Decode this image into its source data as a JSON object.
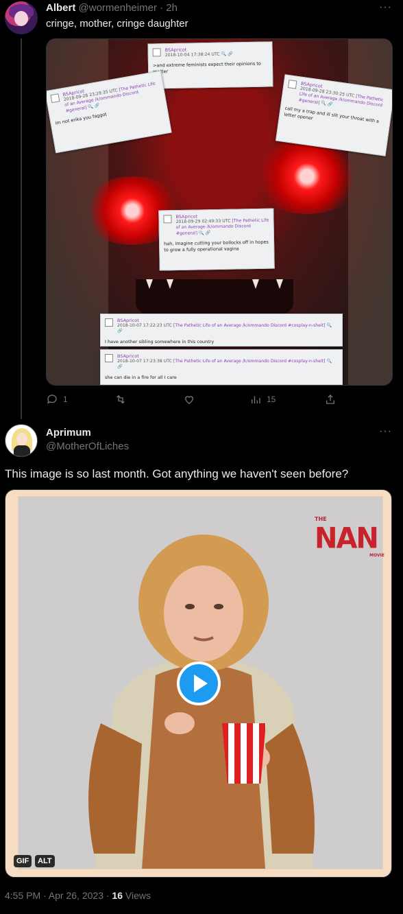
{
  "tweet1": {
    "name": "Albert",
    "handle": "@wormenheimer",
    "separator": "·",
    "time": "2h",
    "more": "···",
    "text": "cringe, mother, cringe daughter",
    "image_cards": [
      {
        "user": "BSApricot",
        "meta": "2018-10-04 17:38:24 UTC",
        "links": "🔍 🔗",
        "body": ">and extreme feminists expect their opinions to matter"
      },
      {
        "user": "BSApricot",
        "meta": "2018-09-28 23:29:35 UTC",
        "links": "[The Pathetic Life of an Average /k/ommando Discord #general] 🔍 🔗",
        "body": "im not erika you faggot"
      },
      {
        "user": "BSApricot",
        "meta": "2018-09-28 23:30:25 UTC",
        "links": "[The Pathetic Life of an Average /k/ommando Discord #general] 🔍 🔗",
        "body": "call my a trap and ill slit your throat with a letter opener"
      },
      {
        "user": "BSApricot",
        "meta": "2018-09-29 02:49:33 UTC",
        "links": "[The Pathetic Life of an Average /k/ommando Discord #general] 🔍 🔗",
        "body": "hah, imagine cutting your bollocks off in hopes to grow a fully operational vagina"
      },
      {
        "user": "BSApricot",
        "meta": "2018-10-07 17:22:23 UTC",
        "links": "[The Pathetic Life of an Average /k/ommando Discord #cosplay-n-sheit] 🔍 🔗",
        "body": "I have another sibling somewhere in this country"
      },
      {
        "user": "BSApricot",
        "meta": "2018-10-07 17:23:38 UTC",
        "links": "[The Pathetic Life of an Average /k/ommando Discord #cosplay-n-sheit] 🔍 🔗",
        "body": "she can die in a fire for all I care"
      }
    ],
    "actions": {
      "replies": "1",
      "retweets": "",
      "likes": "",
      "views": "15"
    }
  },
  "tweet2": {
    "name": "Aprimum",
    "handle": "@MotherOfLiches",
    "more": "···",
    "text": "This image is so last month. Got anything we haven't seen before?",
    "media": {
      "logo_the": "THE",
      "logo_nan": "NAN",
      "logo_movie": "MOVIE",
      "gif_badge": "GIF",
      "alt_badge": "ALT"
    },
    "time": "4:55 PM · Apr 26, 2023 ·",
    "views_count": "16",
    "views_label": "Views"
  },
  "colors": {
    "background": "#000000",
    "text": "#e7e9ea",
    "muted": "#71767b",
    "accent": "#1d9bf0",
    "link_purple": "#8c3fb4"
  }
}
